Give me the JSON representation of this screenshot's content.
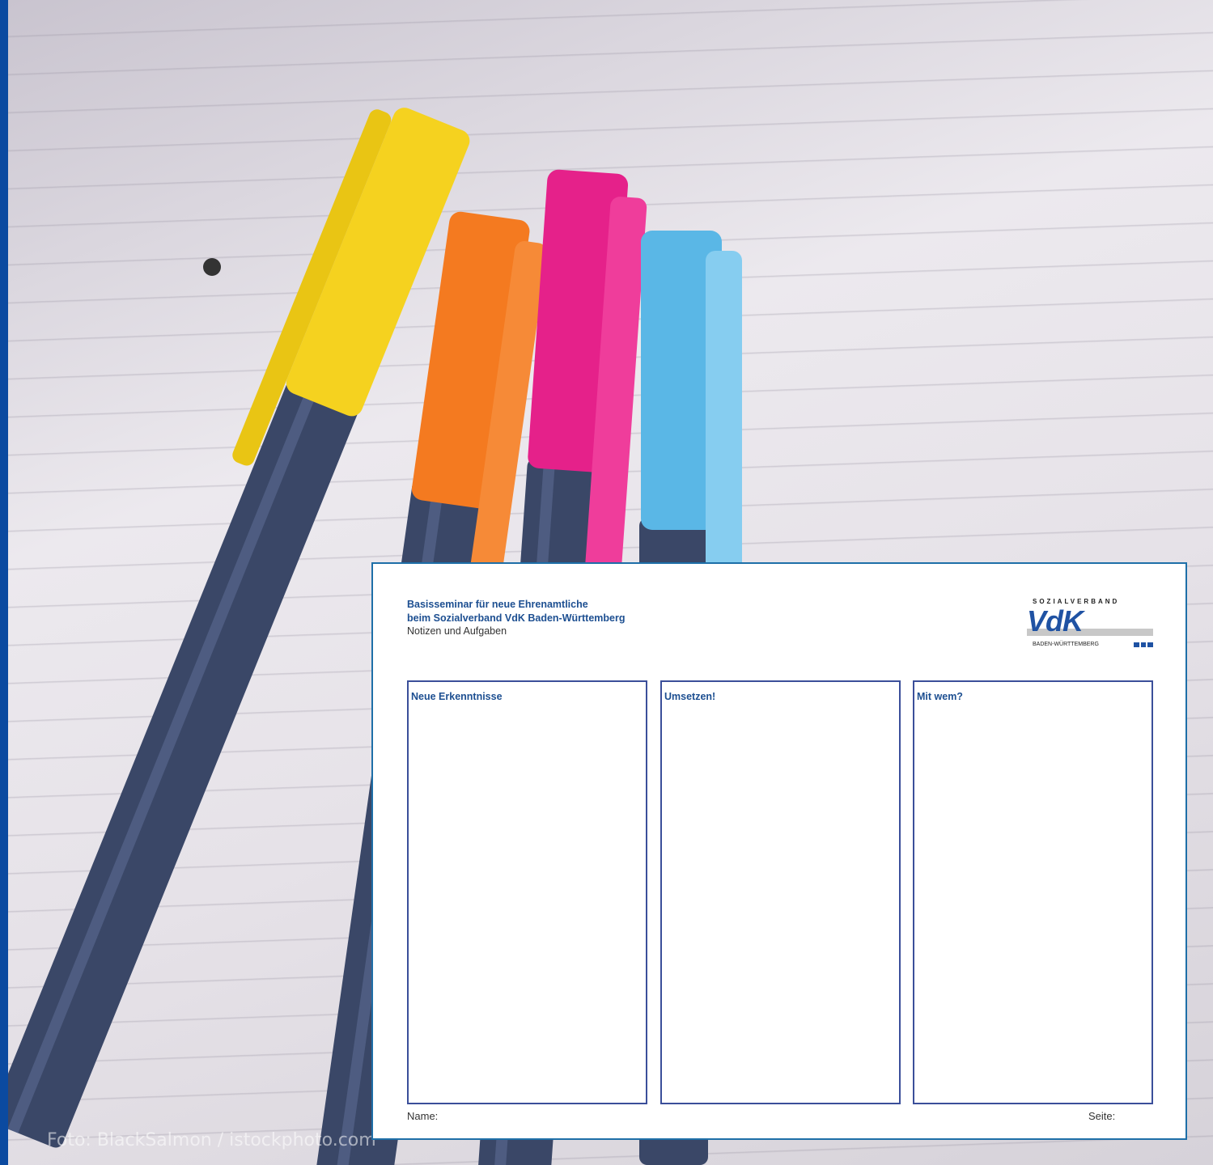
{
  "photo_caption": "Foto: BlackSalmon / istockphoto.com",
  "sheet": {
    "title_line1": "Basisseminar für neue Ehrenamtliche",
    "title_line2": "beim Sozialverband VdK Baden-Württemberg",
    "subtitle": "Notizen und Aufgaben",
    "logo": {
      "top": "SOZIALVERBAND",
      "main": "VdK",
      "bottom": "BADEN-WÜRTTEMBERG"
    },
    "columns": [
      {
        "title": "Neue Erkenntnisse"
      },
      {
        "title": "Umsetzen!"
      },
      {
        "title": "Mit wem?"
      }
    ],
    "footer": {
      "name_label": "Name:",
      "page_label": "Seite:"
    }
  },
  "colors": {
    "brand_blue": "#1d4f91",
    "left_bar": "#0b4aa0",
    "sheet_border": "#1e6fa8",
    "pen_yellow": "#f5d21f",
    "pen_orange": "#f47a20",
    "pen_pink": "#e5218a",
    "pen_blue": "#5ab7e6"
  }
}
